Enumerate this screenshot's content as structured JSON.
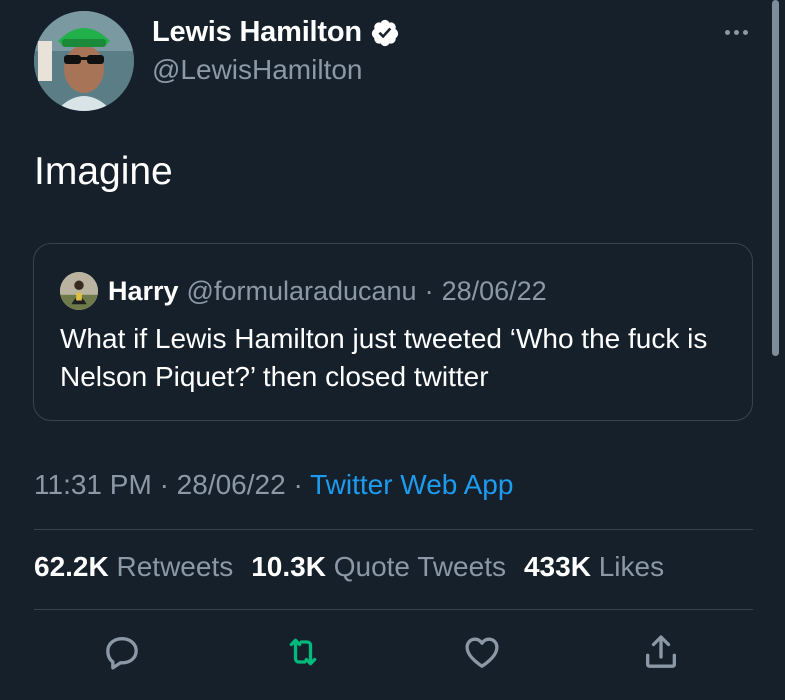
{
  "author": {
    "name": "Lewis Hamilton",
    "handle": "@LewisHamilton",
    "verified_icon": "verified-badge-icon"
  },
  "tweet": {
    "text": "Imagine"
  },
  "quoted_tweet": {
    "name": "Harry",
    "handle": "@formularaducanu",
    "separator": "·",
    "date": "28/06/22",
    "text": "What if Lewis Hamilton just tweeted ‘Who the fuck is Nelson Piquet?’ then closed twitter"
  },
  "meta": {
    "time": "11:31 PM",
    "separator": "·",
    "date": "28/06/22",
    "source": "Twitter Web App"
  },
  "stats": {
    "retweets_count": "62.2K",
    "retweets_label": "Retweets",
    "quotes_count": "10.3K",
    "quotes_label": "Quote Tweets",
    "likes_count": "433K",
    "likes_label": "Likes"
  },
  "actions": {
    "reply_icon": "reply-icon",
    "retweet_icon": "retweet-icon",
    "like_icon": "heart-icon",
    "share_icon": "share-icon"
  },
  "colors": {
    "background": "#15202b",
    "muted_text": "#8b98a5",
    "link": "#1d9bf0",
    "retweet_green": "#00ba7c",
    "border": "#38444d"
  }
}
